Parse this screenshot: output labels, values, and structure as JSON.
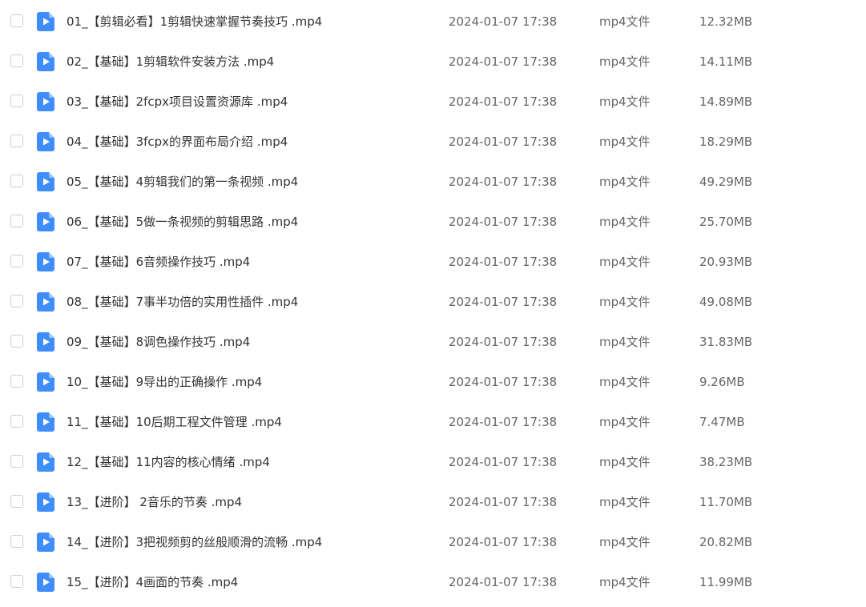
{
  "colors": {
    "video_icon": "#3f8cfb",
    "video_icon_fold": "#9cc4fd",
    "text_primary": "#333333",
    "text_secondary": "#666666"
  },
  "files": [
    {
      "name": "01_【剪辑必看】1剪辑快速掌握节奏技巧 .mp4",
      "date": "2024-01-07 17:38",
      "type": "mp4文件",
      "size": "12.32MB",
      "icon": "video-file-icon"
    },
    {
      "name": "02_【基础】1剪辑软件安装方法 .mp4",
      "date": "2024-01-07 17:38",
      "type": "mp4文件",
      "size": "14.11MB",
      "icon": "video-file-icon"
    },
    {
      "name": "03_【基础】2fcpx项目设置资源库 .mp4",
      "date": "2024-01-07 17:38",
      "type": "mp4文件",
      "size": "14.89MB",
      "icon": "video-file-icon"
    },
    {
      "name": "04_【基础】3fcpx的界面布局介绍 .mp4",
      "date": "2024-01-07 17:38",
      "type": "mp4文件",
      "size": "18.29MB",
      "icon": "video-file-icon"
    },
    {
      "name": "05_【基础】4剪辑我们的第一条视频 .mp4",
      "date": "2024-01-07 17:38",
      "type": "mp4文件",
      "size": "49.29MB",
      "icon": "video-file-icon"
    },
    {
      "name": "06_【基础】5做一条视频的剪辑思路 .mp4",
      "date": "2024-01-07 17:38",
      "type": "mp4文件",
      "size": "25.70MB",
      "icon": "video-file-icon"
    },
    {
      "name": "07_【基础】6音频操作技巧 .mp4",
      "date": "2024-01-07 17:38",
      "type": "mp4文件",
      "size": "20.93MB",
      "icon": "video-file-icon"
    },
    {
      "name": "08_【基础】7事半功倍的实用性插件 .mp4",
      "date": "2024-01-07 17:38",
      "type": "mp4文件",
      "size": "49.08MB",
      "icon": "video-file-icon"
    },
    {
      "name": "09_【基础】8调色操作技巧 .mp4",
      "date": "2024-01-07 17:38",
      "type": "mp4文件",
      "size": "31.83MB",
      "icon": "video-file-icon"
    },
    {
      "name": "10_【基础】9导出的正确操作 .mp4",
      "date": "2024-01-07 17:38",
      "type": "mp4文件",
      "size": "9.26MB",
      "icon": "video-file-icon"
    },
    {
      "name": "11_【基础】10后期工程文件管理 .mp4",
      "date": "2024-01-07 17:38",
      "type": "mp4文件",
      "size": "7.47MB",
      "icon": "video-file-icon"
    },
    {
      "name": "12_【基础】11内容的核心情绪 .mp4",
      "date": "2024-01-07 17:38",
      "type": "mp4文件",
      "size": "38.23MB",
      "icon": "video-file-icon"
    },
    {
      "name": "13_【进阶】 2音乐的节奏 .mp4",
      "date": "2024-01-07 17:38",
      "type": "mp4文件",
      "size": "11.70MB",
      "icon": "video-file-icon"
    },
    {
      "name": "14_【进阶】3把视频剪的丝般顺滑的流畅 .mp4",
      "date": "2024-01-07 17:38",
      "type": "mp4文件",
      "size": "20.82MB",
      "icon": "video-file-icon"
    },
    {
      "name": "15_【进阶】4画面的节奏 .mp4",
      "date": "2024-01-07 17:38",
      "type": "mp4文件",
      "size": "11.99MB",
      "icon": "video-file-icon"
    }
  ]
}
